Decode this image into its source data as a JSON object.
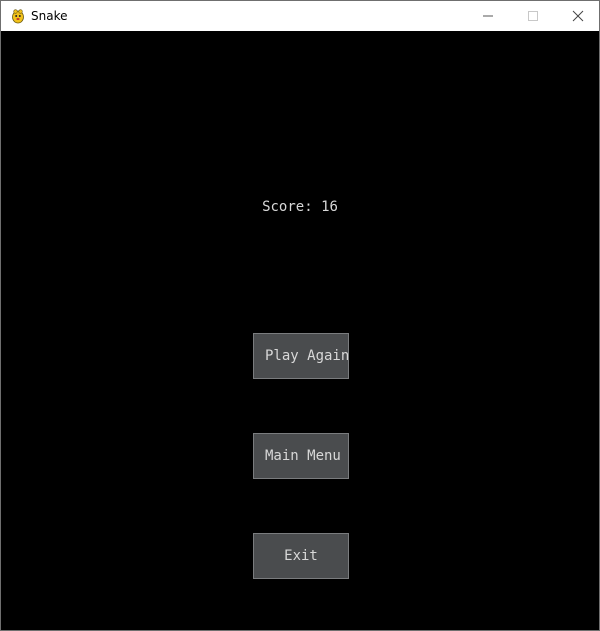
{
  "window": {
    "title": "Snake",
    "icon": "pygame-snake-icon",
    "controls": {
      "minimize_icon": "minimize-icon",
      "maximize_icon": "maximize-icon",
      "close_icon": "close-icon"
    }
  },
  "game_over": {
    "score_text": "Score: 16",
    "buttons": {
      "play_again": "Play Again",
      "main_menu": "Main Menu",
      "exit": "Exit"
    }
  },
  "colors": {
    "background": "#000000",
    "button_fill": "#4a4c4e",
    "button_border": "#7a7c7e",
    "text": "#d8d8d8"
  }
}
